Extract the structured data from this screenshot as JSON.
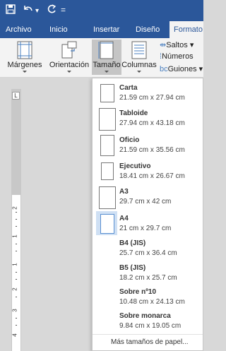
{
  "quick_access": {
    "save_icon": "save-icon",
    "undo_icon": "undo-icon",
    "redo_icon": "redo-icon",
    "customize_label": "="
  },
  "tabs": {
    "items": [
      "Archivo",
      "Inicio",
      "Insertar",
      "Diseño",
      "Formato"
    ],
    "active": "Formato"
  },
  "ribbon": {
    "margins": "Márgenes",
    "orientation": "Orientación",
    "size": "Tamaño",
    "columns": "Columnas",
    "breaks": "Saltos",
    "line_numbers": "Números",
    "hyphenation": "Guiones"
  },
  "ruler": {
    "tab_selector": "L",
    "numbers": [
      "2",
      "1",
      "1",
      "2",
      "3",
      "4"
    ]
  },
  "dropdown": {
    "sizes": [
      {
        "name": "Carta",
        "dims": "21.59 cm x 27.94 cm"
      },
      {
        "name": "Tabloide",
        "dims": "27.94 cm x 43.18 cm"
      },
      {
        "name": "Oficio",
        "dims": "21.59 cm x 35.56 cm"
      },
      {
        "name": "Ejecutivo",
        "dims": "18.41 cm x 26.67 cm"
      },
      {
        "name": "A3",
        "dims": "29.7 cm x 42 cm"
      },
      {
        "name": "A4",
        "dims": "21 cm x 29.7 cm"
      },
      {
        "name": "B4 (JIS)",
        "dims": "25.7 cm x 36.4 cm"
      },
      {
        "name": "B5 (JIS)",
        "dims": "18.2 cm x 25.7 cm"
      },
      {
        "name": "Sobre nº10",
        "dims": "10.48 cm x 24.13 cm"
      },
      {
        "name": "Sobre monarca",
        "dims": "9.84 cm x 19.05 cm"
      }
    ],
    "selected": "A4",
    "more": "Más tamaños de papel..."
  },
  "colors": {
    "title_bar": "#2b579a",
    "ribbon": "#f3f3f3",
    "selected_highlight": "#cfe0f4"
  }
}
